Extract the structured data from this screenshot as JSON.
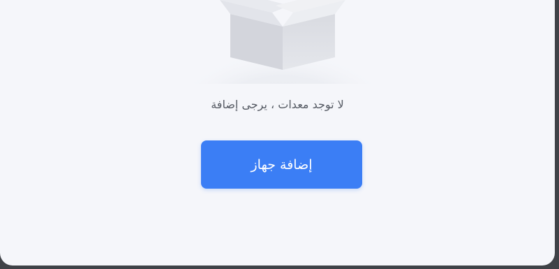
{
  "empty_state": {
    "illustration": "empty-box-icon",
    "message": "لا توجد معدات ، يرجى إضافة",
    "add_button_label": "إضافة جهاز"
  },
  "colors": {
    "card_background": "#f5f6fa",
    "button": "#3b7ef5",
    "text": "#555a63"
  }
}
